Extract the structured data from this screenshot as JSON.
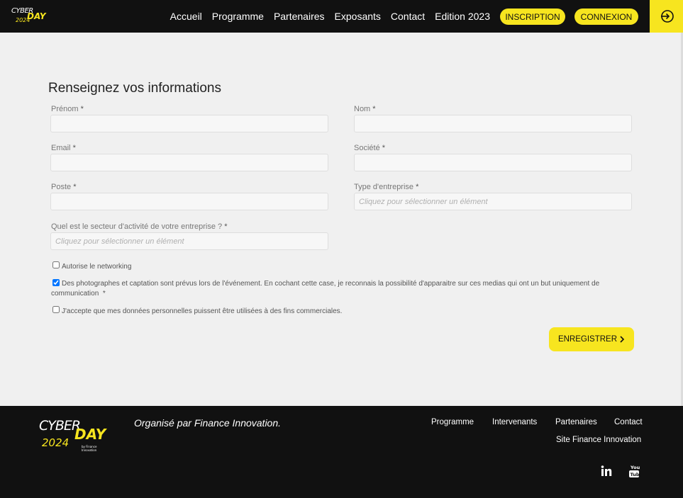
{
  "header": {
    "logo": {
      "line1": "CYBER",
      "line2": "DAY",
      "year": "2024",
      "sub": "by Finance Innovation"
    },
    "nav": [
      "Accueil",
      "Programme",
      "Partenaires",
      "Exposants",
      "Contact",
      "Edition 2023"
    ],
    "inscription_label": "INSCRIPTION",
    "connexion_label": "CONNEXION",
    "login_icon": "login-arrow-icon"
  },
  "form": {
    "title": "Renseignez vos informations",
    "prenom": {
      "label": "Prénom",
      "required": "*",
      "value": ""
    },
    "nom": {
      "label": "Nom",
      "required": "*",
      "value": ""
    },
    "email": {
      "label": "Email",
      "required": "*",
      "value": ""
    },
    "societe": {
      "label": "Société",
      "required": "*",
      "value": ""
    },
    "poste": {
      "label": "Poste",
      "required": "*",
      "value": ""
    },
    "type_entreprise": {
      "label": "Type d'entreprise",
      "required": "*",
      "placeholder": "Cliquez pour sélectionner un élément"
    },
    "secteur": {
      "label": "Quel est le secteur d'activité de votre entreprise ?",
      "required": "*",
      "placeholder": "Cliquez pour sélectionner un élément"
    },
    "checkboxes": {
      "networking": {
        "label": "Autorise le networking",
        "checked": false
      },
      "photos": {
        "label": "Des photographes et captation sont prévus lors de l'événement. En cochant cette case, je reconnais la possibilité d'apparaitre sur ces medias qui ont un but uniquement de communication",
        "required": "*",
        "checked": true
      },
      "commercial": {
        "label": "J'accepte que mes données personnelles puissent être utilisées à des fins commerciales.",
        "checked": false
      }
    },
    "save_label": "ENREGISTRER",
    "save_icon": "chevron-right-icon"
  },
  "footer": {
    "logo": {
      "line1": "CYBER",
      "line2": "DAY",
      "year": "2024",
      "sub": "by Finance Innovation"
    },
    "organiser": "Organisé par Finance Innovation.",
    "links": [
      "Programme",
      "Intervenants",
      "Partenaires",
      "Contact"
    ],
    "site_link": "Site Finance Innovation",
    "social": [
      "linkedin-icon",
      "youtube-icon"
    ]
  },
  "colors": {
    "accent": "#f7e51f",
    "dark": "#111111",
    "background": "#f0f0f0"
  }
}
